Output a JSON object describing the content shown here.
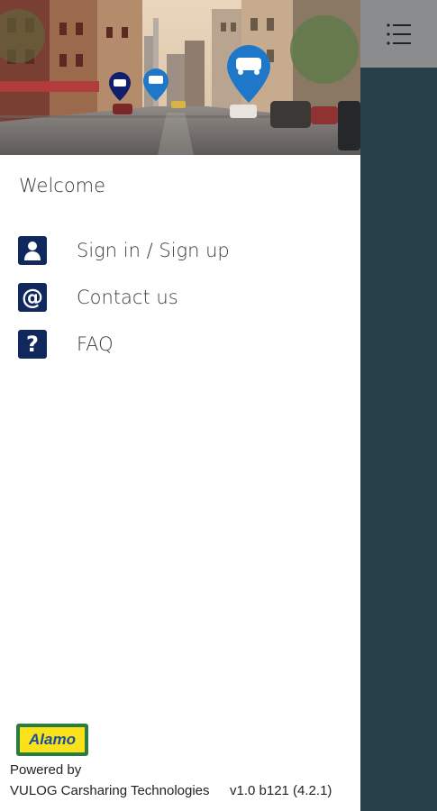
{
  "drawer": {
    "welcome": "Welcome",
    "items": [
      {
        "label": "Sign in / Sign up",
        "icon": "user-icon"
      },
      {
        "label": "Contact us",
        "icon": "at-sign-icon"
      },
      {
        "label": "FAQ",
        "icon": "question-mark-icon"
      }
    ]
  },
  "footer": {
    "logo_text": "Alamo",
    "powered_by": "Powered by",
    "company": "VULOG Carsharing Technologies",
    "version": "v1.0 b121 (4.2.1)"
  },
  "header_icons": [
    "menu-list-icon"
  ],
  "colors": {
    "accent": "#10285c",
    "side_panel": "#27404a",
    "menu_button_bg": "#8a8c8d",
    "marker_blue": "#1f77c9"
  }
}
